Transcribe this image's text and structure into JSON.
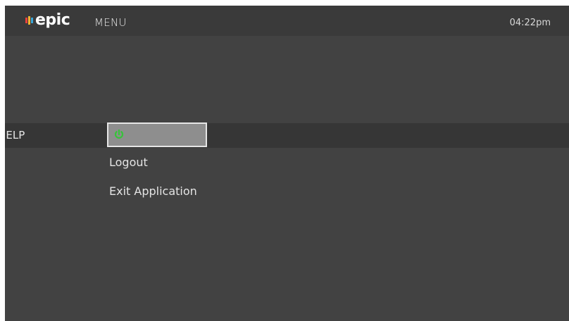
{
  "header": {
    "brand": "epic",
    "logo_icon": "play-stripes-icon",
    "title": "MENU",
    "time": "04:22pm"
  },
  "nav": {
    "current_label": "IELP"
  },
  "submenu": {
    "power_icon": "power-icon",
    "power_icon_color": "#36c43a",
    "items": [
      {
        "label": "Logout"
      },
      {
        "label": "Exit Application"
      }
    ]
  },
  "colors": {
    "background": "#424242",
    "topbar": "#3a3a3a",
    "nav_row": "#363636",
    "selected_item": "#8e8e8e",
    "logo_red": "#e8413c",
    "logo_yellow": "#f2b632",
    "logo_blue": "#3aa6d8"
  }
}
